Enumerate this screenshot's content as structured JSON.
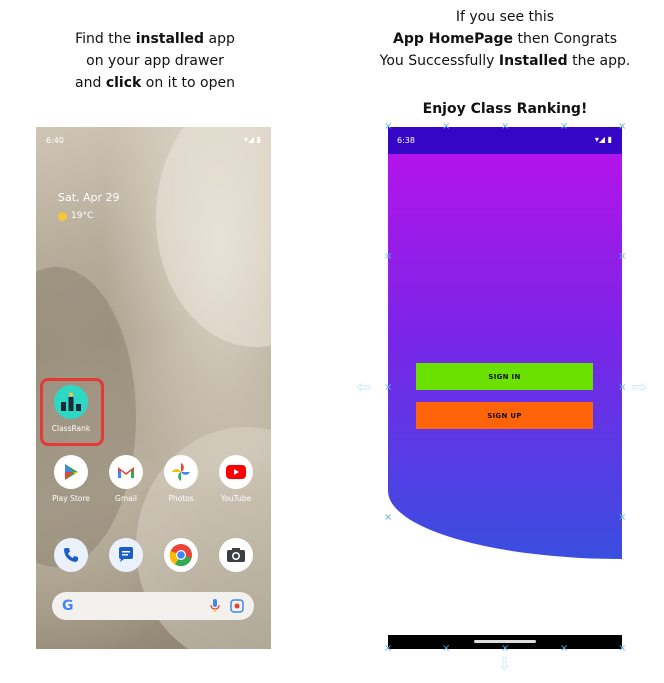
{
  "left_caption": {
    "line1_pre": "Find the ",
    "line1_bold": "installed",
    "line1_post": " app",
    "line2": "on your app drawer",
    "line3_pre": "and ",
    "line3_bold": "click",
    "line3_post": " on it to open"
  },
  "right_caption": {
    "line1": "If you see this",
    "line2_bold": "App HomePage",
    "line2_post": " then Congrats",
    "line3_pre": "You Successfully ",
    "line3_bold": "Installed",
    "line3_post": " the app.",
    "enjoy": "Enjoy Class Ranking!"
  },
  "home_screen": {
    "time": "6:40",
    "date": "Sat, Apr 29",
    "weather": "19°C",
    "highlighted_app": {
      "label": "ClassRank",
      "icon": "classrank-icon"
    },
    "apps_row1": [
      {
        "label": "Play Store",
        "icon": "play-store-icon"
      },
      {
        "label": "Gmail",
        "icon": "gmail-icon"
      },
      {
        "label": "Photos",
        "icon": "photos-icon"
      },
      {
        "label": "YouTube",
        "icon": "youtube-icon"
      }
    ],
    "dock": [
      {
        "icon": "phone-icon"
      },
      {
        "icon": "messages-icon"
      },
      {
        "icon": "chrome-icon"
      },
      {
        "icon": "camera-icon"
      }
    ],
    "search": {
      "logo": "G"
    }
  },
  "app_screen": {
    "time": "6:38",
    "signin_label": "SIGN IN",
    "signup_label": "SIGN UP",
    "colors": {
      "status": "#3506c6",
      "signin": "#6be100",
      "signup": "#ff6408",
      "gradient_top": "#b214ea",
      "gradient_bottom": "#3a4ee0"
    }
  }
}
